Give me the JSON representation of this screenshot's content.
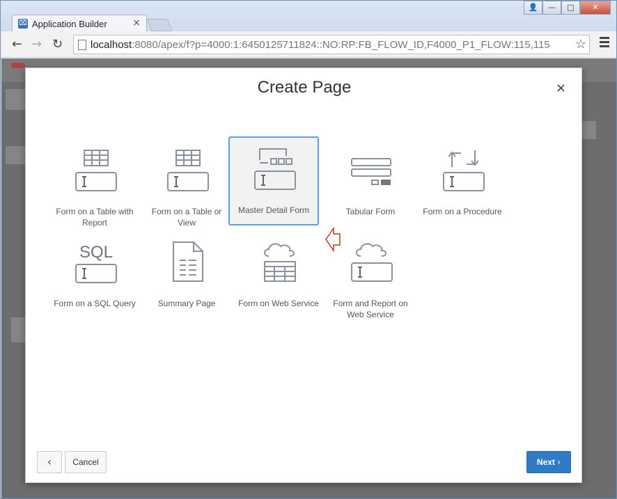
{
  "browser": {
    "tab_title": "Application Builder",
    "tab_close": "×",
    "favicon_glyph": "⌧",
    "url_host": "localhost",
    "url_rest": ":8080/apex/f?p=4000:1:6450125711824::NO:RP:FB_FLOW_ID,F4000_P1_FLOW:115,115",
    "back_glyph": "←",
    "forward_glyph": "→",
    "reload_glyph": "↻",
    "star_glyph": "☆",
    "win_min": "—",
    "win_max": "□",
    "win_close": "✕",
    "win_user": "👤"
  },
  "modal": {
    "title": "Create Page",
    "close_glyph": "×",
    "tiles": [
      {
        "label": "Form on a Table with Report",
        "icon": "table-form-icon",
        "selected": false
      },
      {
        "label": "Form on a Table or View",
        "icon": "table-form-icon",
        "selected": false
      },
      {
        "label": "Master Detail Form",
        "icon": "master-detail-icon",
        "selected": true
      },
      {
        "label": "Tabular Form",
        "icon": "tabular-form-icon",
        "selected": false
      },
      {
        "label": "Form on a Procedure",
        "icon": "procedure-icon",
        "selected": false
      },
      {
        "label": "Form on a SQL Query",
        "icon": "sql-form-icon",
        "selected": false
      },
      {
        "label": "Summary Page",
        "icon": "document-icon",
        "selected": false
      },
      {
        "label": "Form on Web Service",
        "icon": "cloud-table-icon",
        "selected": false
      },
      {
        "label": "Form and Report on Web Service",
        "icon": "cloud-form-icon",
        "selected": false
      }
    ],
    "sql_text": "SQL",
    "back_glyph": "‹",
    "cancel_label": "Cancel",
    "next_label": "Next",
    "next_glyph": "›"
  },
  "colors": {
    "accent": "#2f7bc3",
    "selection_border": "#5d9cec",
    "icon_stroke": "#8a919c",
    "pointer_red": "#c0392b"
  }
}
